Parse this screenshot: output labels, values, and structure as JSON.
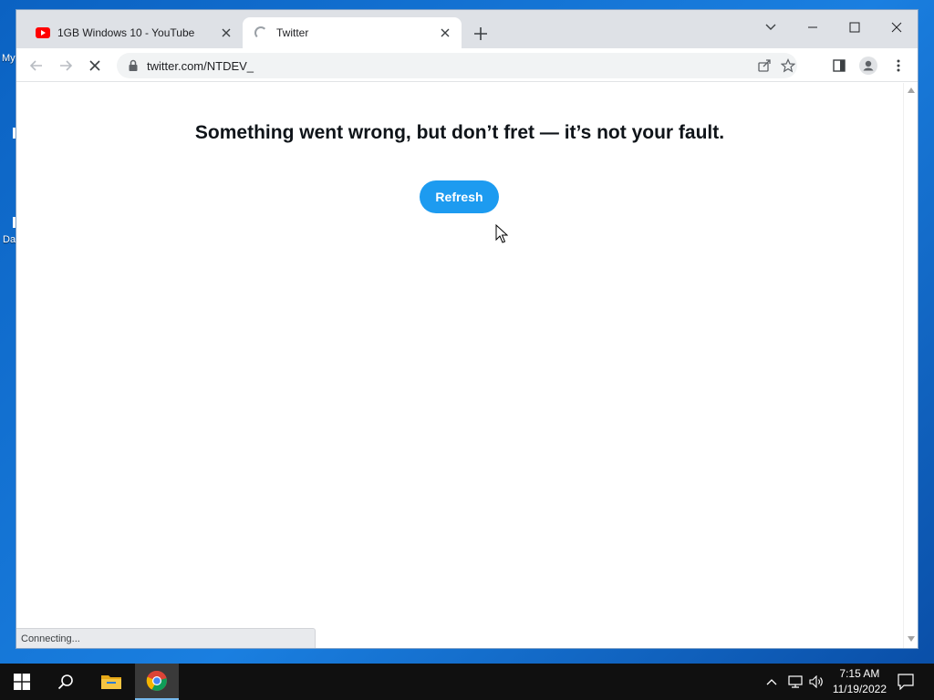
{
  "desktop": {
    "fragments": [
      "My",
      "Da"
    ]
  },
  "browser": {
    "tabs": [
      {
        "title": "1GB Windows 10 - YouTube",
        "favicon": "youtube-icon",
        "active": false
      },
      {
        "title": "Twitter",
        "favicon": "loading-spinner-icon",
        "active": true
      }
    ],
    "address": "twitter.com/NTDEV_",
    "status_text": "Connecting..."
  },
  "page": {
    "headline": "Something went wrong, but don’t fret — it’s not your fault.",
    "refresh_label": "Refresh"
  },
  "taskbar": {
    "time": "7:15 AM",
    "date": "11/19/2022",
    "apps": [
      "start-icon",
      "search-icon",
      "file-explorer-icon",
      "chrome-icon"
    ]
  },
  "colors": {
    "twitter_blue": "#1d9bf0",
    "youtube_red": "#ff0000",
    "desktop_blue": "#0b62c2"
  }
}
